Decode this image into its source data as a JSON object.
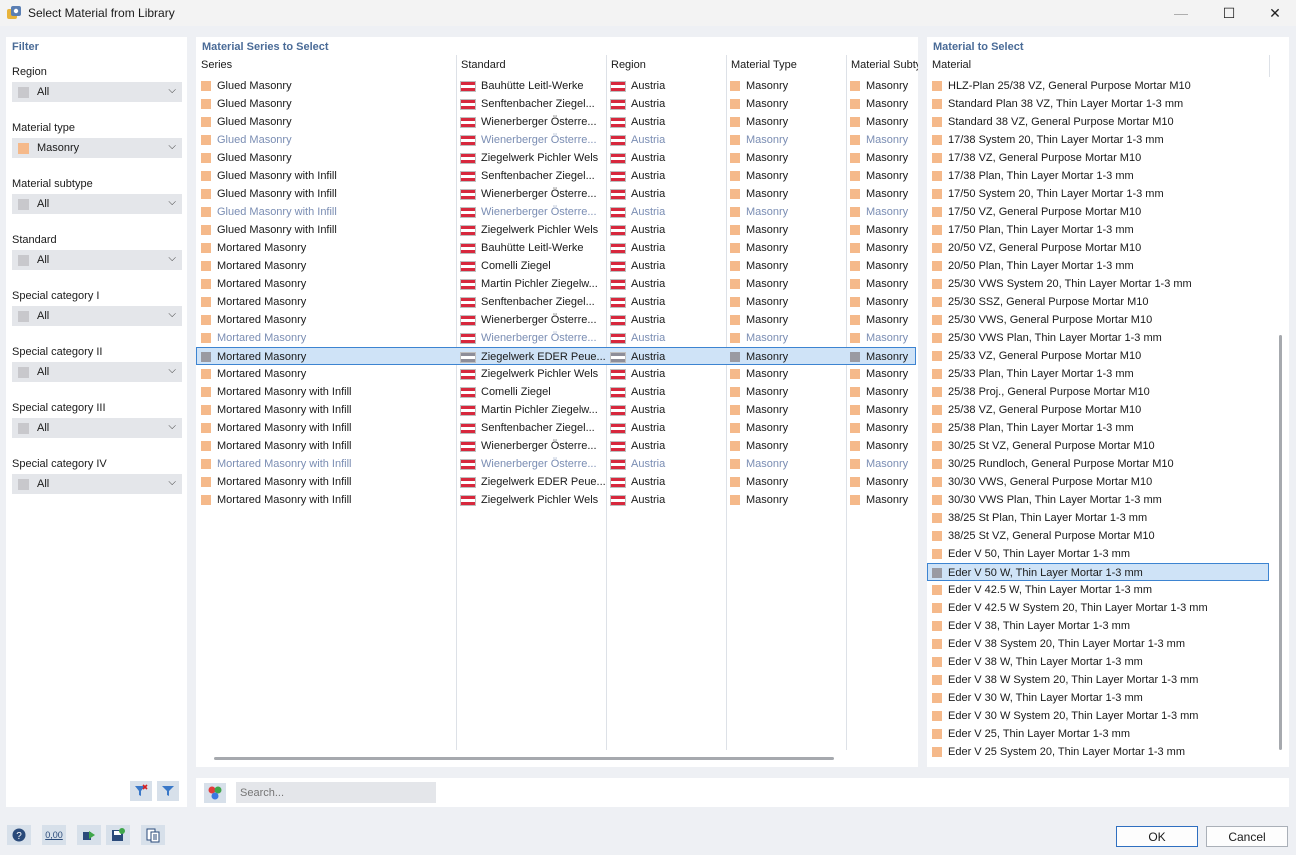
{
  "window": {
    "title": "Select Material from Library",
    "minimize": "—",
    "maximize": "☐",
    "close": "✕"
  },
  "filter": {
    "header": "Filter",
    "groups": [
      {
        "label": "Region",
        "value": "All",
        "color": "#c8c8cc"
      },
      {
        "label": "Material type",
        "value": "Masonry",
        "color": "#f5b98a"
      },
      {
        "label": "Material subtype",
        "value": "All",
        "color": "#c8c8cc"
      },
      {
        "label": "Standard",
        "value": "All",
        "color": "#c8c8cc"
      },
      {
        "label": "Special category I",
        "value": "All",
        "color": "#c8c8cc"
      },
      {
        "label": "Special category II",
        "value": "All",
        "color": "#c8c8cc"
      },
      {
        "label": "Special category III",
        "value": "All",
        "color": "#c8c8cc"
      },
      {
        "label": "Special category IV",
        "value": "All",
        "color": "#c8c8cc"
      }
    ]
  },
  "series": {
    "header": "Material Series to Select",
    "columns": [
      "Series",
      "Standard",
      "Region",
      "Material Type",
      "Material Subtype"
    ],
    "rows": [
      {
        "series": "Glued Masonry",
        "standard": "Bauhütte Leitl-Werke",
        "region": "Austria",
        "type": "Masonry",
        "subtype": "Masonry",
        "state": "normal"
      },
      {
        "series": "Glued Masonry",
        "standard": "Senftenbacher Ziegel...",
        "region": "Austria",
        "type": "Masonry",
        "subtype": "Masonry",
        "state": "normal"
      },
      {
        "series": "Glued Masonry",
        "standard": "Wienerberger Österre...",
        "region": "Austria",
        "type": "Masonry",
        "subtype": "Masonry",
        "state": "normal"
      },
      {
        "series": "Glued Masonry",
        "standard": "Wienerberger Österre...",
        "region": "Austria",
        "type": "Masonry",
        "subtype": "Masonry",
        "state": "dim"
      },
      {
        "series": "Glued Masonry",
        "standard": "Ziegelwerk Pichler Wels",
        "region": "Austria",
        "type": "Masonry",
        "subtype": "Masonry",
        "state": "normal"
      },
      {
        "series": "Glued Masonry with Infill",
        "standard": "Senftenbacher Ziegel...",
        "region": "Austria",
        "type": "Masonry",
        "subtype": "Masonry",
        "state": "normal"
      },
      {
        "series": "Glued Masonry with Infill",
        "standard": "Wienerberger Österre...",
        "region": "Austria",
        "type": "Masonry",
        "subtype": "Masonry",
        "state": "normal"
      },
      {
        "series": "Glued Masonry with Infill",
        "standard": "Wienerberger Österre...",
        "region": "Austria",
        "type": "Masonry",
        "subtype": "Masonry",
        "state": "dim"
      },
      {
        "series": "Glued Masonry with Infill",
        "standard": "Ziegelwerk Pichler Wels",
        "region": "Austria",
        "type": "Masonry",
        "subtype": "Masonry",
        "state": "normal"
      },
      {
        "series": "Mortared Masonry",
        "standard": "Bauhütte Leitl-Werke",
        "region": "Austria",
        "type": "Masonry",
        "subtype": "Masonry",
        "state": "normal"
      },
      {
        "series": "Mortared Masonry",
        "standard": "Comelli Ziegel",
        "region": "Austria",
        "type": "Masonry",
        "subtype": "Masonry",
        "state": "normal"
      },
      {
        "series": "Mortared Masonry",
        "standard": "Martin Pichler Ziegelw...",
        "region": "Austria",
        "type": "Masonry",
        "subtype": "Masonry",
        "state": "normal"
      },
      {
        "series": "Mortared Masonry",
        "standard": "Senftenbacher Ziegel...",
        "region": "Austria",
        "type": "Masonry",
        "subtype": "Masonry",
        "state": "normal"
      },
      {
        "series": "Mortared Masonry",
        "standard": "Wienerberger Österre...",
        "region": "Austria",
        "type": "Masonry",
        "subtype": "Masonry",
        "state": "normal"
      },
      {
        "series": "Mortared Masonry",
        "standard": "Wienerberger Österre...",
        "region": "Austria",
        "type": "Masonry",
        "subtype": "Masonry",
        "state": "dim"
      },
      {
        "series": "Mortared Masonry",
        "standard": "Ziegelwerk EDER Peue...",
        "region": "Austria",
        "type": "Masonry",
        "subtype": "Masonry",
        "state": "selected"
      },
      {
        "series": "Mortared Masonry",
        "standard": "Ziegelwerk Pichler Wels",
        "region": "Austria",
        "type": "Masonry",
        "subtype": "Masonry",
        "state": "normal"
      },
      {
        "series": "Mortared Masonry with Infill",
        "standard": "Comelli Ziegel",
        "region": "Austria",
        "type": "Masonry",
        "subtype": "Masonry",
        "state": "normal"
      },
      {
        "series": "Mortared Masonry with Infill",
        "standard": "Martin Pichler Ziegelw...",
        "region": "Austria",
        "type": "Masonry",
        "subtype": "Masonry",
        "state": "normal"
      },
      {
        "series": "Mortared Masonry with Infill",
        "standard": "Senftenbacher Ziegel...",
        "region": "Austria",
        "type": "Masonry",
        "subtype": "Masonry",
        "state": "normal"
      },
      {
        "series": "Mortared Masonry with Infill",
        "standard": "Wienerberger Österre...",
        "region": "Austria",
        "type": "Masonry",
        "subtype": "Masonry",
        "state": "normal"
      },
      {
        "series": "Mortared Masonry with Infill",
        "standard": "Wienerberger Österre...",
        "region": "Austria",
        "type": "Masonry",
        "subtype": "Masonry",
        "state": "dim"
      },
      {
        "series": "Mortared Masonry with Infill",
        "standard": "Ziegelwerk EDER Peue...",
        "region": "Austria",
        "type": "Masonry",
        "subtype": "Masonry",
        "state": "normal"
      },
      {
        "series": "Mortared Masonry with Infill",
        "standard": "Ziegelwerk Pichler Wels",
        "region": "Austria",
        "type": "Masonry",
        "subtype": "Masonry",
        "state": "normal"
      }
    ]
  },
  "materials": {
    "header": "Material to Select",
    "column": "Material",
    "selected_index": 27,
    "items": [
      "HLZ-Plan 25/38 VZ, General Purpose Mortar M10",
      "Standard Plan 38 VZ, Thin Layer Mortar 1-3 mm",
      "Standard 38 VZ, General Purpose Mortar M10",
      "17/38 System 20, Thin Layer Mortar 1-3 mm",
      "17/38 VZ, General Purpose Mortar M10",
      "17/38 Plan, Thin Layer Mortar 1-3 mm",
      "17/50 System 20, Thin Layer Mortar 1-3 mm",
      "17/50 VZ, General Purpose Mortar M10",
      "17/50 Plan, Thin Layer Mortar 1-3 mm",
      "20/50 VZ, General Purpose Mortar M10",
      "20/50 Plan, Thin Layer Mortar 1-3 mm",
      "25/30 VWS System 20, Thin Layer Mortar 1-3 mm",
      "25/30 SSZ, General Purpose Mortar M10",
      "25/30 VWS, General Purpose Mortar M10",
      "25/30 VWS Plan, Thin Layer Mortar 1-3 mm",
      "25/33 VZ, General Purpose Mortar M10",
      "25/33 Plan, Thin Layer Mortar 1-3 mm",
      "25/38 Proj., General Purpose Mortar M10",
      "25/38 VZ, General Purpose Mortar M10",
      "25/38 Plan, Thin Layer Mortar 1-3 mm",
      "30/25 St VZ, General Purpose Mortar M10",
      "30/25 Rundloch, General Purpose Mortar M10",
      "30/30 VWS, General Purpose Mortar M10",
      "30/30 VWS Plan, Thin Layer Mortar 1-3 mm",
      "38/25 St Plan, Thin Layer Mortar 1-3 mm",
      "38/25 St VZ, General Purpose Mortar M10",
      "Eder V 50, Thin Layer Mortar 1-3 mm",
      "Eder V 50 W, Thin Layer Mortar 1-3 mm",
      "Eder V 42.5 W, Thin Layer Mortar 1-3 mm",
      "Eder V 42.5 W System 20, Thin Layer Mortar 1-3 mm",
      "Eder V 38, Thin Layer Mortar 1-3 mm",
      "Eder V 38 System 20, Thin Layer Mortar 1-3 mm",
      "Eder V 38 W, Thin Layer Mortar 1-3 mm",
      "Eder V 38 W System 20, Thin Layer Mortar 1-3 mm",
      "Eder V 30 W, Thin Layer Mortar 1-3 mm",
      "Eder V 30 W System 20, Thin Layer Mortar 1-3 mm",
      "Eder V 25, Thin Layer Mortar 1-3 mm",
      "Eder V 25 System 20, Thin Layer Mortar 1-3 mm"
    ]
  },
  "search": {
    "placeholder": "Search..."
  },
  "buttons": {
    "ok": "OK",
    "cancel": "Cancel"
  },
  "footer_icons": [
    "help-icon",
    "units-icon",
    "export-icon",
    "save-icon",
    "library-icon"
  ],
  "footer_units_text": "0,00",
  "colors": {
    "masonry": "#f5b98a",
    "selected_swatch": "#9a9aa2",
    "accent": "#4a6b97",
    "selection_border": "#3d84d1"
  }
}
